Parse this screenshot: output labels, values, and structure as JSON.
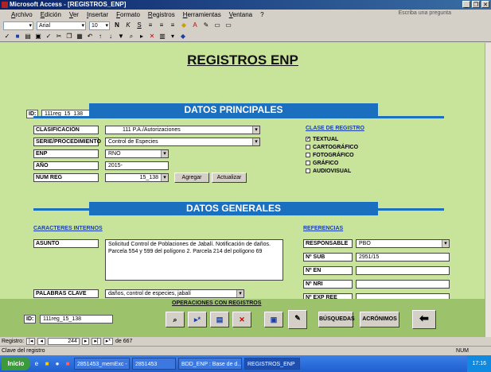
{
  "window": {
    "title": "Microsoft Access - [REGISTROS_ENP]",
    "help_placeholder": "Escriba una pregunta"
  },
  "menu": [
    "Archivo",
    "Edición",
    "Ver",
    "Insertar",
    "Formato",
    "Registros",
    "Herramientas",
    "Ventana",
    "?"
  ],
  "toolbar": {
    "font": "Arial",
    "size": "10"
  },
  "form": {
    "title": "REGISTROS ENP",
    "id_label": "ID:",
    "id_value": "111reg_15_138",
    "principales": {
      "header": "DATOS PRINCIPALES",
      "clasificacion_label": "CLASIFICACIÓN",
      "clasificacion_value": "111 P.A./Autorizaciones",
      "serie_label": "SERIE/PROCEDIMIENTO",
      "serie_value": "Control de Especies",
      "enp_label": "ENP",
      "enp_value": "RNO",
      "anio_label": "AÑO",
      "anio_value": "2015-",
      "numreg_label": "NUM REG",
      "numreg_value": "15_138",
      "agregar": "Agregar",
      "actualizar": "Actualizar",
      "clase_title": "CLASE DE REGISTRO",
      "clases": [
        {
          "label": "TEXTUAL",
          "checked": true
        },
        {
          "label": "CARTOGRÁFICO",
          "checked": false
        },
        {
          "label": "FOTOGRÁFICO",
          "checked": false
        },
        {
          "label": "GRÁFICO",
          "checked": false
        },
        {
          "label": "AUDIOVISUAL",
          "checked": false
        }
      ]
    },
    "generales": {
      "header": "DATOS GENERALES",
      "caracteres_title": "CARACTERES INTERNOS",
      "asunto_label": "ASUNTO",
      "asunto_value": "Solicitud Control de Poblaciones de Jabalí. Notificación de daños. Parcela 554 y 599 del polígono 2. Parcela 214 del polígono 69",
      "palabras_label": "PALABRAS CLAVE",
      "palabras_value": "daños, control de especies, jabalí",
      "referencias_title": "REFERENCIAS",
      "responsable_label": "RESPONSABLE",
      "responsable_value": "PBO",
      "nsub_label": "Nº SUB",
      "nsub_value": "2951/15",
      "nen_label": "Nº EN",
      "nri_label": "Nº NRI",
      "nexp_label": "Nº EXP REE"
    },
    "bottom": {
      "operaciones": "OPERACIONES CON REGISTROS",
      "id_label": "ID:",
      "id_value": "111reg_15_138",
      "busquedas": "BÚSQUEDAS",
      "acronimos": "ACRÓNIMOS"
    }
  },
  "record_nav": {
    "label": "Registro:",
    "current": "244",
    "of_text": "de 667"
  },
  "status": {
    "text": "Clave del registro",
    "num": "NUM"
  },
  "taskbar": {
    "start": "Inicio",
    "tasks": [
      "2851453_memExc - ...",
      "2851453",
      "BDD_ENP : Base de d...",
      "REGISTROS_ENP"
    ],
    "clock": "17:16"
  }
}
